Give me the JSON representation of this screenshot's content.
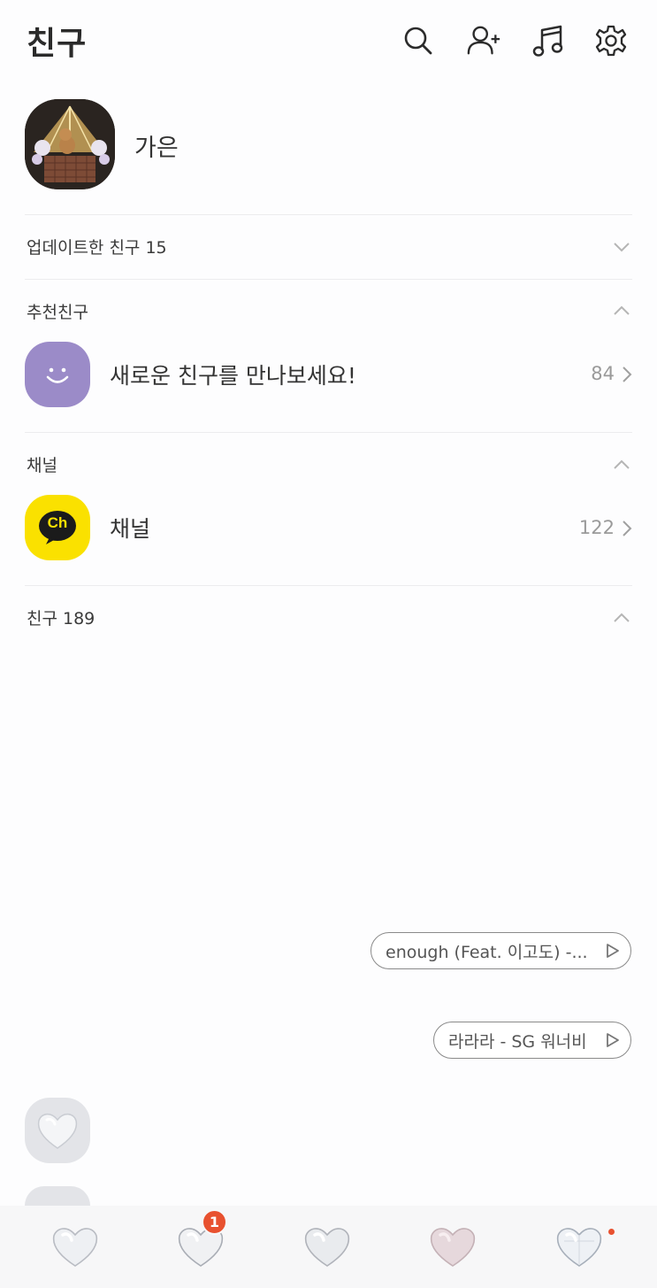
{
  "header": {
    "title": "친구",
    "icons": [
      "search-icon",
      "add-friend-icon",
      "music-note-icon",
      "gear-icon"
    ]
  },
  "profile": {
    "name": "가은"
  },
  "sections": {
    "updated": {
      "label": "업데이트한 친구 15",
      "expanded": false
    },
    "recommended": {
      "label": "추천친구",
      "expanded": true,
      "row_text": "새로운 친구를 만나보세요!",
      "row_count": "84"
    },
    "channel": {
      "label": "채널",
      "expanded": true,
      "row_icon_text": "Ch",
      "row_text": "채널",
      "row_count": "122"
    },
    "friends": {
      "label": "친구 189",
      "expanded": true
    }
  },
  "music_pills": [
    {
      "text": "enough (Feat. 이고도) -..."
    },
    {
      "text": "라라라 - SG 워너비"
    }
  ],
  "bottom_tabs": [
    {
      "icon": "heart-crystal-icon"
    },
    {
      "icon": "heart-crystal-icon",
      "badge": "1"
    },
    {
      "icon": "heart-crystal-icon"
    },
    {
      "icon": "heart-rose-quartz-icon"
    },
    {
      "icon": "heart-crystal-icon",
      "dot": true
    }
  ],
  "colors": {
    "recommend_purple": "#9b8bc8",
    "channel_yellow": "#fae100",
    "badge_red": "#e8512f"
  }
}
